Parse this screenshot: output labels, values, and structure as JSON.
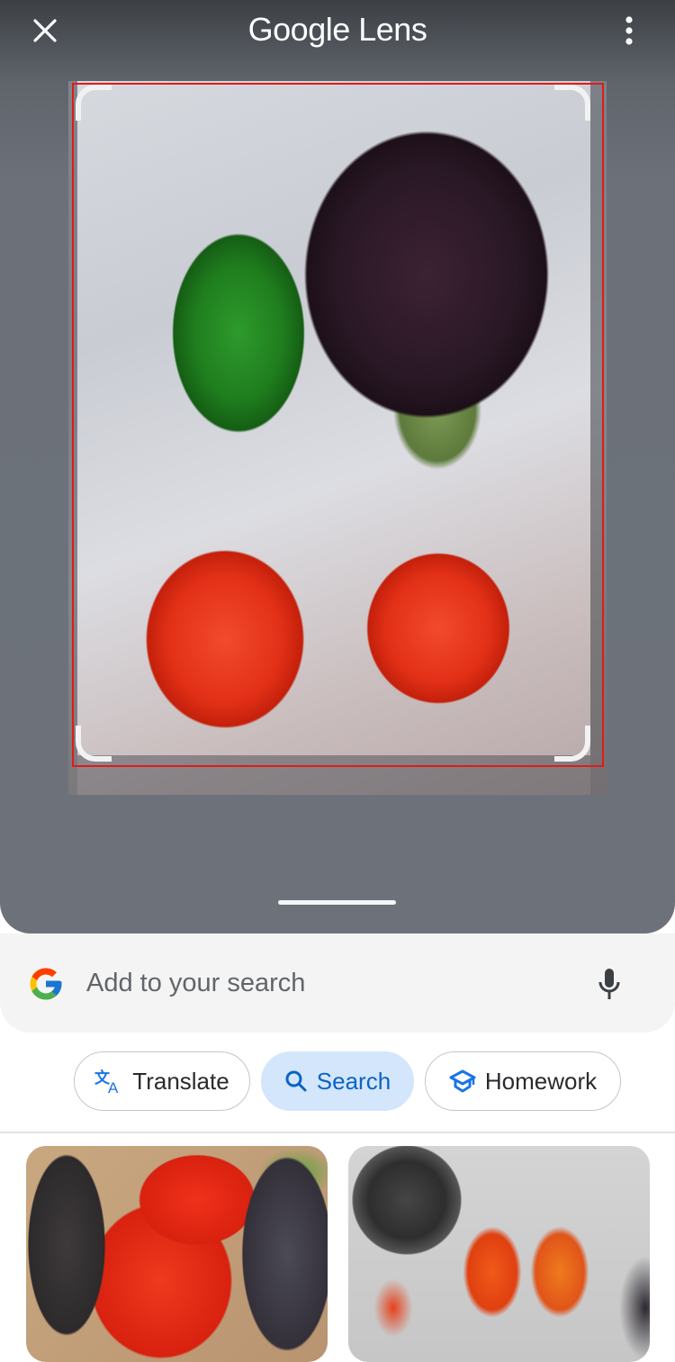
{
  "header": {
    "title_brand": "Google",
    "title_product": "Lens",
    "close_icon": "close-icon",
    "menu_icon": "more-vert-icon"
  },
  "viewer": {
    "image_description": "Green bell pepper, eggplant and two red roma tomatoes on a white cloth",
    "selection_color": "#e01b1b"
  },
  "search": {
    "placeholder": "Add to your search",
    "value": "",
    "logo_icon": "google-g-icon",
    "mic_icon": "mic-icon"
  },
  "chips": [
    {
      "label": "Translate",
      "icon": "translate-icon",
      "active": false
    },
    {
      "label": "Search",
      "icon": "search-icon",
      "active": true
    },
    {
      "label": "Homework",
      "icon": "graduation-cap-icon",
      "active": false
    }
  ],
  "colors": {
    "accent": "#1a73e8",
    "active_chip_bg": "#d3e6fb",
    "active_chip_text": "#0b63c4"
  },
  "results": [
    {
      "description": "Tomatoes and eggplants close-up"
    },
    {
      "description": "Red and orange peppers in a bowl near a stove"
    }
  ]
}
